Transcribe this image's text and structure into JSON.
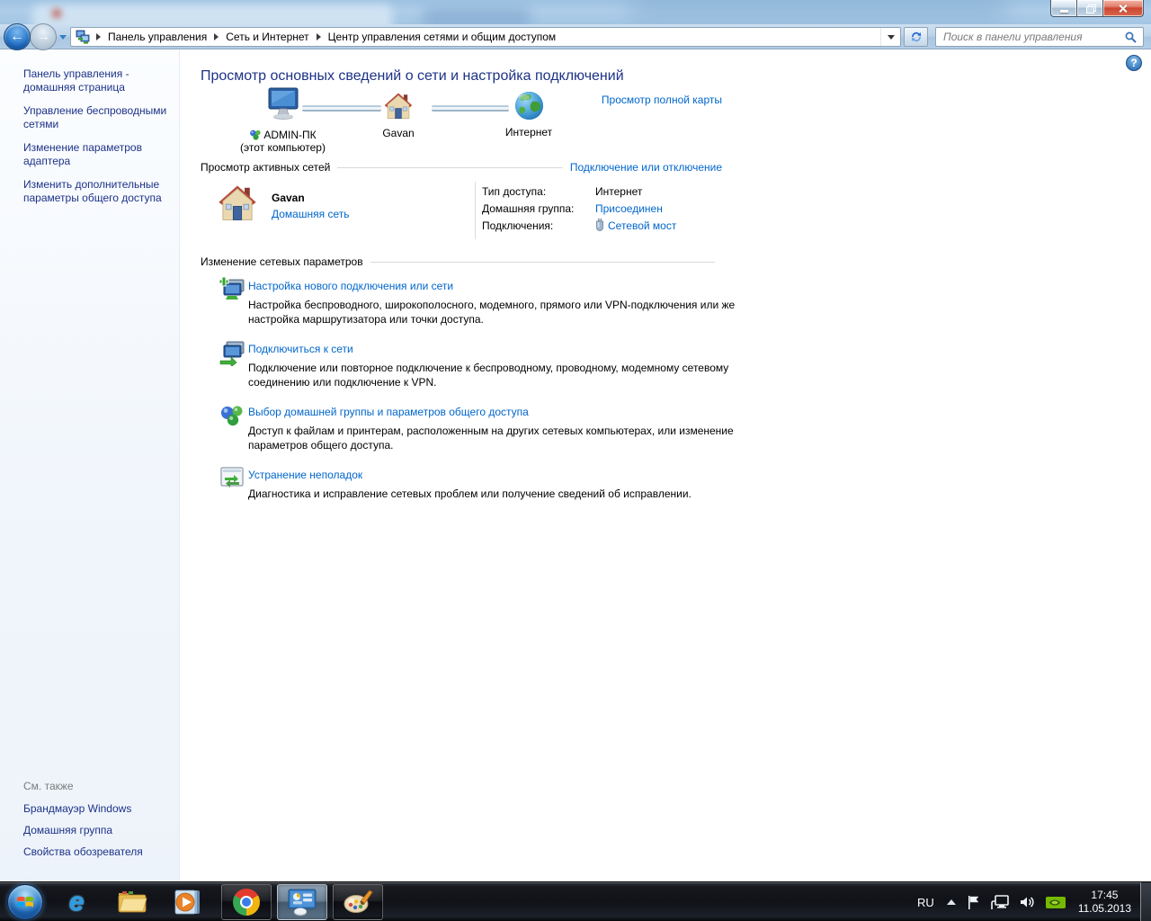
{
  "colors": {
    "heading_blue": "#1d3287",
    "link_blue": "#0066cc",
    "close_red": "#cc4631",
    "nvidia_green": "#76b900",
    "taskbar_black": "#101218"
  },
  "window": {
    "controls": [
      {
        "name": "minimize"
      },
      {
        "name": "maximize"
      },
      {
        "name": "close"
      }
    ]
  },
  "nav": {
    "breadcrumbs": [
      "Панель управления",
      "Сеть и Интернет",
      "Центр управления сетями и общим доступом"
    ],
    "search_placeholder": "Поиск в панели управления"
  },
  "sidebar": {
    "items": [
      {
        "label": "Панель управления - домашняя страница"
      },
      {
        "label": "Управление беспроводными сетями"
      },
      {
        "label": "Изменение параметров адаптера"
      },
      {
        "label": "Изменить дополнительные параметры общего доступа"
      }
    ],
    "see_also_label": "См. также",
    "see_also_items": [
      {
        "label": "Брандмауэр Windows"
      },
      {
        "label": "Домашняя группа"
      },
      {
        "label": "Свойства обозревателя"
      }
    ]
  },
  "main": {
    "title": "Просмотр основных сведений о сети и настройка подключений",
    "full_map_link": "Просмотр полной карты",
    "map": {
      "nodes": [
        {
          "label": "ADMIN-ПК",
          "sublabel": "(этот компьютер)",
          "icon": "computer"
        },
        {
          "label": "Gavan",
          "icon": "house"
        },
        {
          "label": "Интернет",
          "icon": "globe"
        }
      ]
    },
    "active_networks": {
      "header": "Просмотр активных сетей",
      "connect_link": "Подключение или отключение",
      "network": {
        "name": "Gavan",
        "location_link": "Домашняя сеть",
        "details": [
          {
            "label": "Тип доступа:",
            "value": "Интернет"
          },
          {
            "label": "Домашняя группа:",
            "value": "Присоединен"
          },
          {
            "label": "Подключения:",
            "value": "Сетевой мост"
          }
        ]
      }
    },
    "change_settings": {
      "header": "Изменение сетевых параметров",
      "tasks": [
        {
          "title": "Настройка нового подключения или сети",
          "desc": "Настройка беспроводного, широкополосного, модемного, прямого или VPN-подключения или же настройка маршрутизатора или точки доступа."
        },
        {
          "title": "Подключиться к сети",
          "desc": "Подключение или повторное подключение к беспроводному, проводному, модемному сетевому соединению или подключение к VPN."
        },
        {
          "title": "Выбор домашней группы и параметров общего доступа",
          "desc": "Доступ к файлам и принтерам, расположенным на других сетевых компьютерах, или изменение параметров общего доступа."
        },
        {
          "title": "Устранение неполадок",
          "desc": "Диагностика и исправление сетевых проблем или получение сведений об исправлении."
        }
      ]
    }
  },
  "taskbar": {
    "buttons": [
      {
        "name": "start"
      },
      {
        "name": "internet-explorer"
      },
      {
        "name": "windows-explorer"
      },
      {
        "name": "windows-media-player"
      },
      {
        "name": "google-chrome",
        "framed": true
      },
      {
        "name": "control-panel",
        "framed": true,
        "active": true
      },
      {
        "name": "paint",
        "framed": true
      }
    ],
    "tray": {
      "language": "RU",
      "time": "17:45",
      "date": "11.05.2013"
    }
  }
}
